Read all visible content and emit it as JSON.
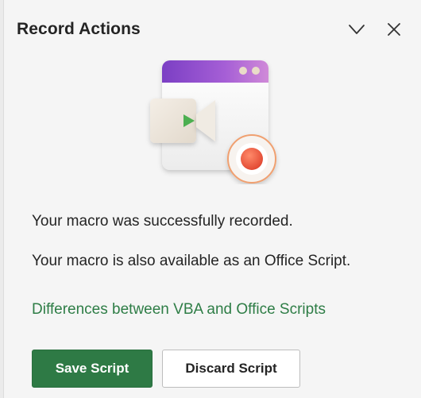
{
  "header": {
    "title": "Record Actions",
    "collapse_icon": "chevron-down-icon",
    "close_icon": "close-icon"
  },
  "illustration": {
    "icon": "record-macro-illustration"
  },
  "messages": {
    "recorded": "Your macro was successfully recorded.",
    "available": "Your macro is also available as an Office Script."
  },
  "link": {
    "label": "Differences between VBA and Office Scripts"
  },
  "actions": {
    "save_label": "Save Script",
    "discard_label": "Discard Script"
  },
  "colors": {
    "accent": "#2e7a45",
    "link": "#2e7d46",
    "record": "#e8573e"
  }
}
